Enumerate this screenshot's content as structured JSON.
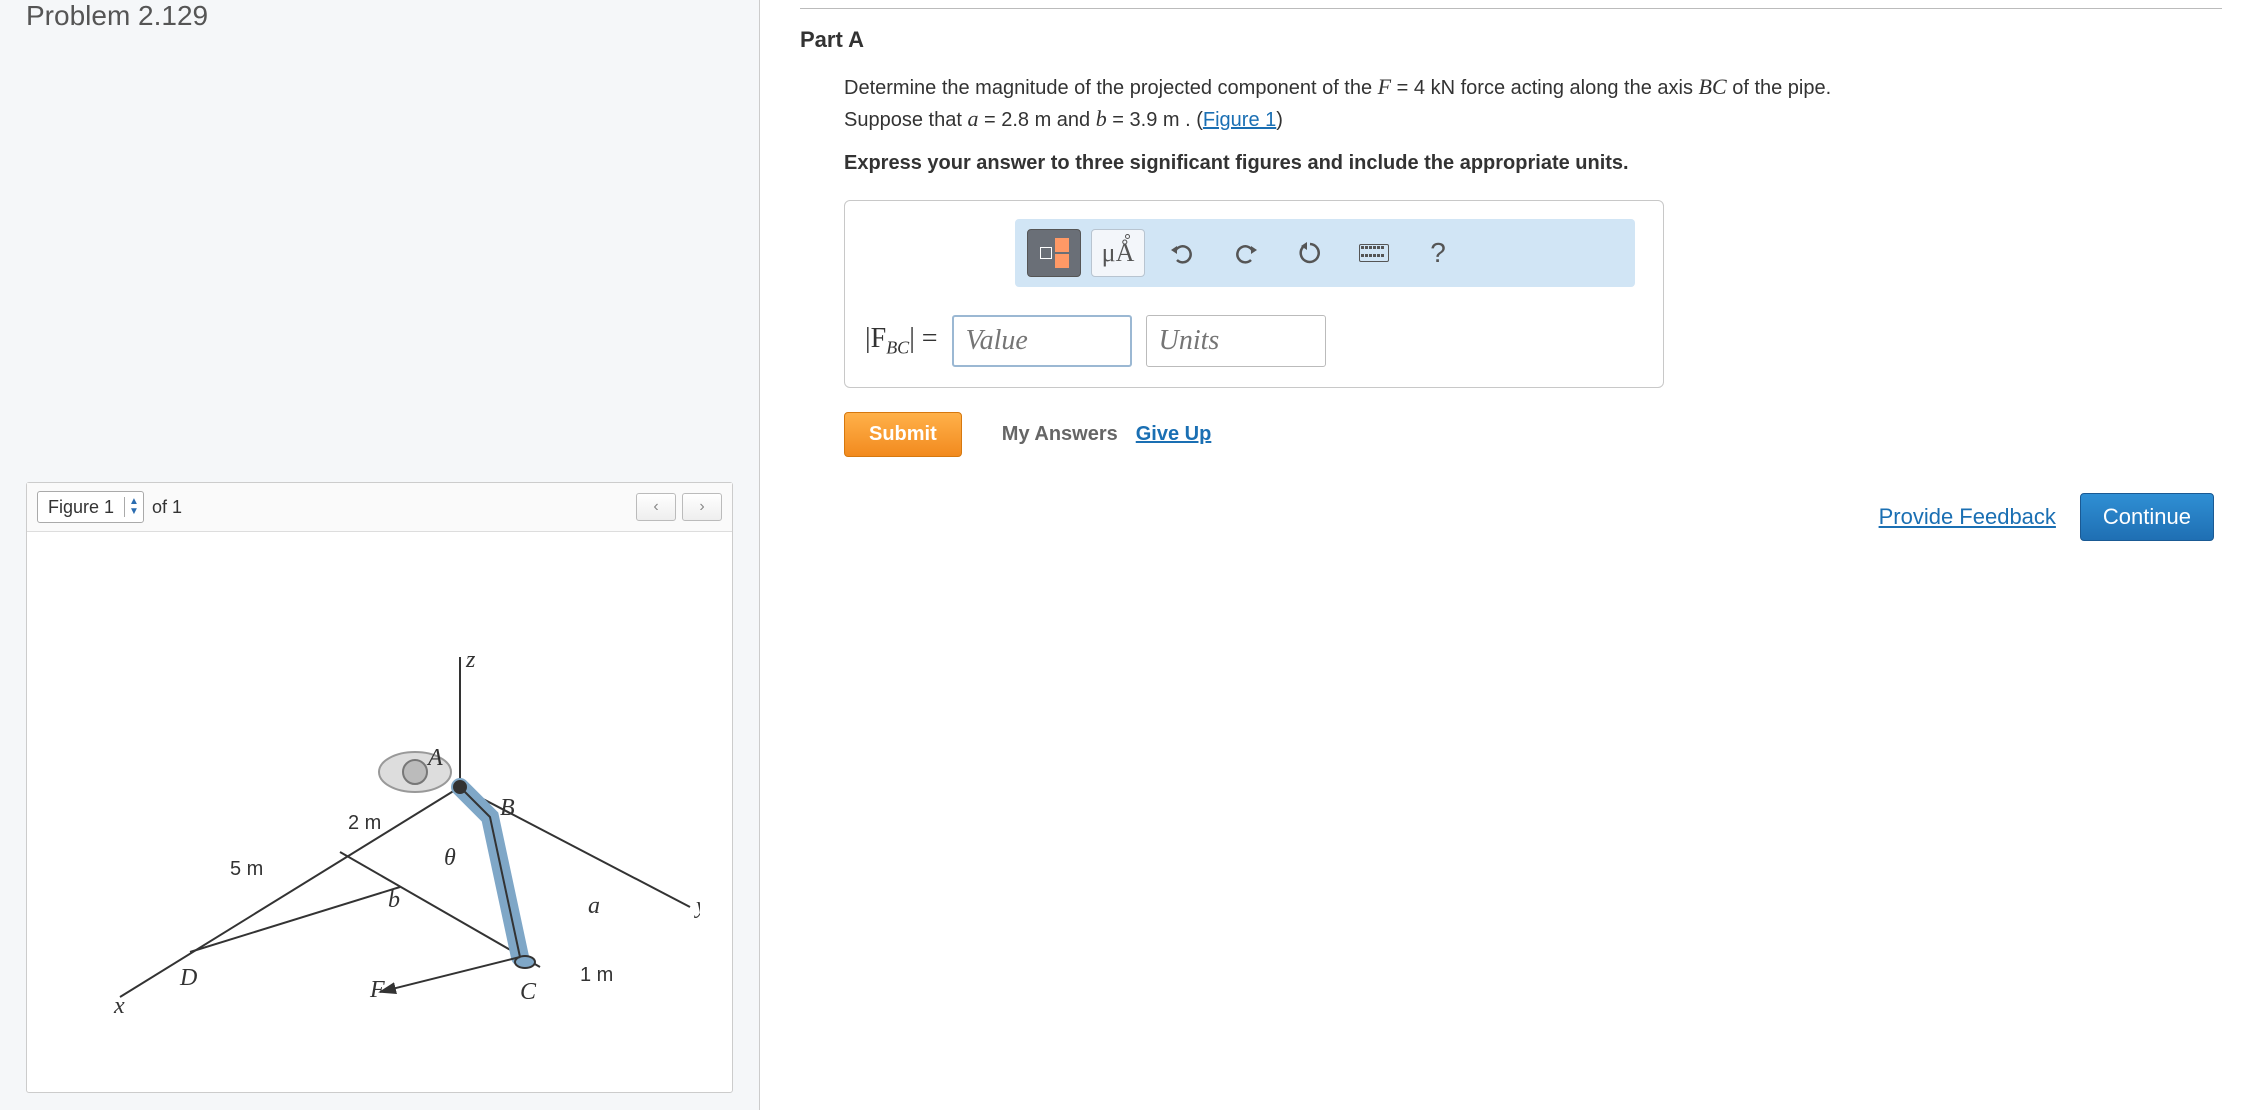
{
  "problem_title": "Problem 2.129",
  "figure": {
    "label": "Figure 1",
    "of_text": "of 1",
    "prev": "‹",
    "next": "›",
    "diagram": {
      "points": [
        "A",
        "B",
        "C",
        "D"
      ],
      "axes": [
        "x",
        "y",
        "z"
      ],
      "dims": {
        "AB_offset": "2 m",
        "five": "5 m",
        "one": "1 m"
      },
      "vars": [
        "a",
        "b",
        "θ",
        "F"
      ]
    }
  },
  "part": {
    "title": "Part A",
    "prompt_1a": "Determine the magnitude of the projected component of the ",
    "F_eq": "F",
    "F_val": " = 4  kN",
    "prompt_1b": " force acting along the axis ",
    "BC": "BC",
    "prompt_1c": " of the pipe.",
    "prompt_2a": "Suppose that ",
    "a_var": "a",
    "a_val": " = 2.8   m",
    "and": " and ",
    "b_var": "b",
    "b_val": " = 3.9   m",
    "period": " . (",
    "fig_link": "Figure 1",
    "close": ")",
    "instruction": "Express your answer to three significant figures and include the appropriate units."
  },
  "toolbar": {
    "mu_a": "μÅ",
    "help": "?"
  },
  "answer": {
    "var_label_open": "|",
    "var_F": "F",
    "var_sub": "BC",
    "var_label_close": "| =",
    "value_ph": "Value",
    "units_ph": "Units"
  },
  "actions": {
    "submit": "Submit",
    "my_answers": "My Answers",
    "give_up": "Give Up",
    "provide_feedback": "Provide Feedback",
    "continue": "Continue"
  }
}
